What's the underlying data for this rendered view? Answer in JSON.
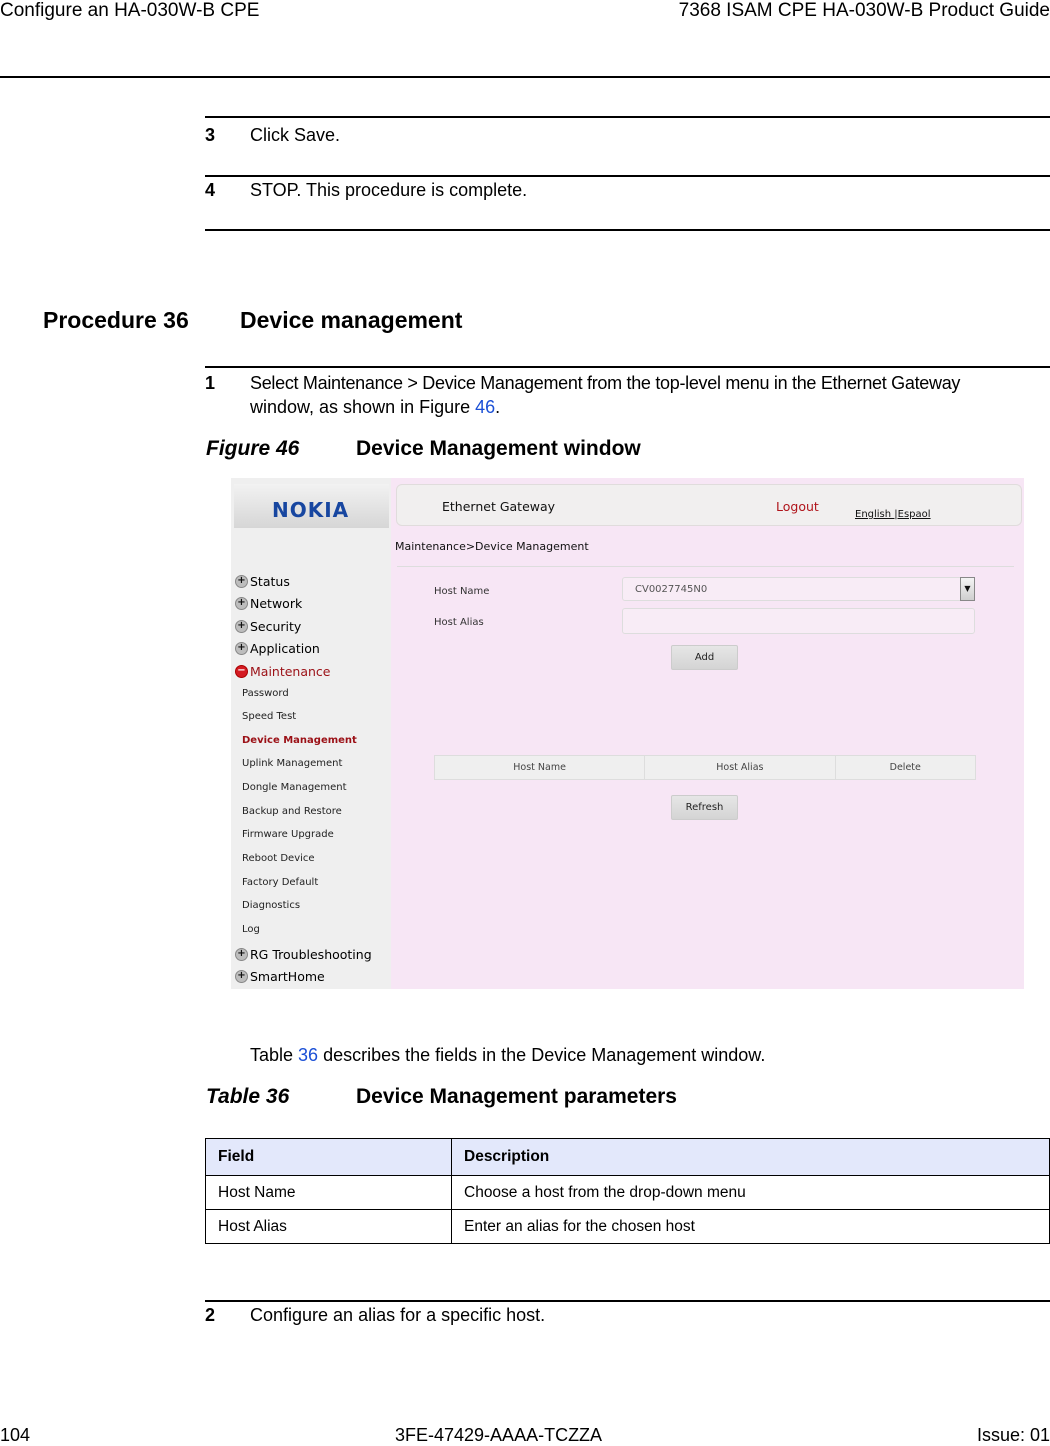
{
  "page_header": {
    "left": "Configure an HA-030W-B CPE",
    "right": "7368 ISAM CPE HA-030W-B Product Guide"
  },
  "steps_prev": [
    {
      "num": "3",
      "text": "Click Save."
    },
    {
      "num": "4",
      "text": "STOP. This procedure is complete."
    }
  ],
  "procedure": {
    "label": "Procedure 36",
    "title": "Device management"
  },
  "step1": {
    "num": "1",
    "text_line1": "Select Maintenance > Device Management from the top-level menu in the Ethernet Gateway",
    "text_line2_pre": "window, as shown in Figure ",
    "text_line2_link": "46",
    "text_line2_post": "."
  },
  "figure": {
    "label": "Figure 46",
    "title": "Device Management window"
  },
  "ui": {
    "logo": "NOKIA",
    "app_title": "Ethernet Gateway",
    "logout": "Logout",
    "lang": "English |Espaol",
    "breadcrumb": "Maintenance>Device Management",
    "menu": [
      {
        "label": "Status",
        "type": "main",
        "icon": "plus"
      },
      {
        "label": "Network",
        "type": "main",
        "icon": "plus"
      },
      {
        "label": "Security",
        "type": "main",
        "icon": "plus"
      },
      {
        "label": "Application",
        "type": "main",
        "icon": "plus"
      },
      {
        "label": "Maintenance",
        "type": "main",
        "icon": "minus",
        "active": true
      },
      {
        "label": "Password",
        "type": "sub"
      },
      {
        "label": "Speed Test",
        "type": "sub"
      },
      {
        "label": "Device Management",
        "type": "sub",
        "active": true
      },
      {
        "label": "Uplink Management",
        "type": "sub"
      },
      {
        "label": "Dongle Management",
        "type": "sub"
      },
      {
        "label": "Backup and Restore",
        "type": "sub"
      },
      {
        "label": "Firmware Upgrade",
        "type": "sub"
      },
      {
        "label": "Reboot Device",
        "type": "sub"
      },
      {
        "label": "Factory Default",
        "type": "sub"
      },
      {
        "label": "Diagnostics",
        "type": "sub"
      },
      {
        "label": "Log",
        "type": "sub"
      },
      {
        "label": "RG Troubleshooting",
        "type": "main",
        "icon": "plus"
      },
      {
        "label": "SmartHome",
        "type": "main",
        "icon": "plus"
      }
    ],
    "host_name_label": "Host Name",
    "host_name_value": "CV0027745N0",
    "host_alias_label": "Host Alias",
    "host_alias_value": "",
    "add_button": "Add",
    "table_headers": [
      "Host Name",
      "Host Alias",
      "Delete"
    ],
    "refresh_button": "Refresh",
    "colors": {
      "logo": "#1746a0",
      "logout": "#b0141b",
      "active_menu": "#9b1016",
      "content_bg": "#f7e6f5"
    }
  },
  "intro": {
    "pre": "Table ",
    "link": "36",
    "post": " describes the fields in the Device Management window."
  },
  "table": {
    "label": "Table 36",
    "title": "Device Management parameters",
    "headers": [
      "Field",
      "Description"
    ],
    "rows": [
      [
        "Host Name",
        "Choose a host from the drop-down menu"
      ],
      [
        "Host Alias",
        "Enter an alias for the chosen host"
      ]
    ]
  },
  "step2": {
    "num": "2",
    "text": "Configure an alias for a specific host."
  },
  "footer": {
    "page": "104",
    "doc_id": "3FE-47429-AAAA-TCZZA",
    "issue": "Issue: 01"
  }
}
